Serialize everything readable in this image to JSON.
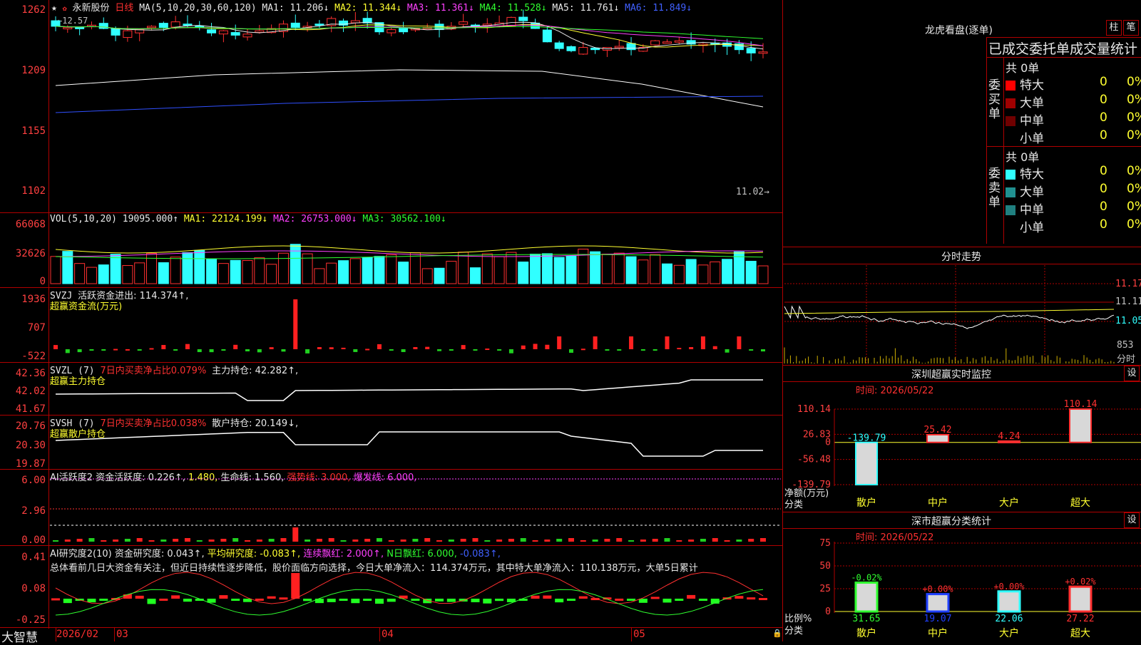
{
  "main_chart": {
    "star": "★",
    "stock_name": "永新股份",
    "period": "日线",
    "ma_header": "MA(5,10,20,30,60,120)",
    "ma1": "MA1: 11.206↓",
    "ma2": "MA2: 11.344↓",
    "ma3": "MA3: 11.361↓",
    "ma4": "MA4: 11.528↓",
    "ma5": "MA5: 11.761↓",
    "ma6": "MA6: 11.849↓",
    "high_label": "12.57",
    "low_label": "11.02→",
    "y_ticks": [
      "1262",
      "1209",
      "1155",
      "1102"
    ],
    "colors": {
      "ma1": "#e8e8e8",
      "ma2": "#ffff30",
      "ma3": "#ff40ff",
      "ma4": "#30ff30",
      "ma5": "#ffffff",
      "ma6": "#3050ff",
      "up": "#ff3030",
      "down": "#30ffff"
    }
  },
  "volume_panel": {
    "header": "VOL(5,10,20)",
    "value": "19095.000↑",
    "ma1": "MA1: 22124.199↓",
    "ma2": "MA2: 26753.000↓",
    "ma3": "MA3: 30562.100↓",
    "y_ticks": [
      "66068",
      "32626",
      "0"
    ]
  },
  "svzj_panel": {
    "header": "SVZJ",
    "line1": "活跃资金进出: 114.374↑,",
    "line2": "超赢资金流(万元)",
    "y_ticks": [
      "1936",
      "707",
      "-522"
    ]
  },
  "svzl_panel": {
    "header": "SVZL (7)",
    "ratio": "7日内买卖净占比0.079%",
    "holding": "主力持仓: 42.282↑,",
    "sub": "超赢主力持仓",
    "y_ticks": [
      "42.36",
      "42.02",
      "41.67"
    ]
  },
  "svsh_panel": {
    "header": "SVSH (7)",
    "ratio": "7日内买卖净占比0.038%",
    "holding": "散户持仓: 20.149↓,",
    "sub": "超赢散户持仓",
    "y_ticks": [
      "20.76",
      "20.30",
      "19.87"
    ]
  },
  "ai_active_panel": {
    "header": "AI活跃度2",
    "active": "资金活跃度: 0.226↑,",
    "v2": "1.480,",
    "life": "生命线: 1.560,",
    "strong": "强势线: 3.000,",
    "burst": "爆发线: 6.000,",
    "y_ticks": [
      "6.00",
      "2.96",
      "0.00"
    ]
  },
  "ai_research_panel": {
    "header": "AI研究度2(10)",
    "research": "资金研究度: 0.043↑,",
    "avg": "平均研究度: -0.083↑,",
    "consecutive": "连续飘红: 2.000↑,",
    "n_days": "N日飘红: 6.000,",
    "last": "-0.083↑,",
    "comment": "总体看前几日大资金有关注，但近日持续性逐步降低，股价面临方向选择，今日大单净流入：114.374万元，其中特大单净流入：110.138万元，大单5日累计",
    "y_ticks": [
      "0.41",
      "0.08",
      "-0.25"
    ]
  },
  "bottom_bar": {
    "brand": "大智慧",
    "date_start": "2026/02",
    "months": [
      "03",
      "04",
      "05"
    ]
  },
  "dragon_tiger": {
    "title": "龙虎看盘(逐单)",
    "btn1": "柱",
    "btn2": "笔",
    "subtitle": "已成交委托单成交量统计",
    "buy_label": "委买单",
    "sell_label": "委卖单",
    "buy_total": "共 0单",
    "sell_total": "共 0单",
    "rows": [
      {
        "name": "特大",
        "count": "0",
        "pct": "0%"
      },
      {
        "name": "大单",
        "count": "0",
        "pct": "0%"
      },
      {
        "name": "中单",
        "count": "0",
        "pct": "0%"
      },
      {
        "name": "小单",
        "count": "0",
        "pct": "0%"
      }
    ],
    "buy_colors": [
      "#ff0000",
      "#a00000",
      "#700000",
      "#000000"
    ],
    "sell_colors": [
      "#30ffff",
      "#209090",
      "#208080",
      "#000000"
    ]
  },
  "intraday": {
    "title": "分时走势",
    "y_ticks": [
      "11.17",
      "11.11",
      "11.05"
    ],
    "vol_label": "853",
    "vol_unit": "分时"
  },
  "sz_monitor": {
    "title": "深圳超赢实时监控",
    "settings": "设",
    "time": "时间: 2026/05/22",
    "y_ticks": [
      "110.14",
      "26.83",
      "0",
      "-56.48",
      "-139.79"
    ],
    "ylabel1": "净额(万元)",
    "ylabel2": "分类",
    "categories": [
      "散户",
      "中户",
      "大户",
      "超大"
    ],
    "values": [
      -139.79,
      25.42,
      4.24,
      110.14
    ],
    "value_labels": [
      "-139.79",
      "25.42",
      "4.24",
      "110.14"
    ]
  },
  "sz_classify": {
    "title": "深市超赢分类统计",
    "settings": "设",
    "time": "时间: 2026/05/22",
    "y_ticks": [
      "75",
      "50",
      "25",
      "0"
    ],
    "ylabel1": "比例%",
    "ylabel2": "分类",
    "categories": [
      "散户",
      "中户",
      "大户",
      "超大"
    ],
    "values": [
      31.65,
      19.07,
      22.06,
      27.22
    ],
    "value_labels": [
      "31.65",
      "19.07",
      "22.06",
      "27.22"
    ],
    "change_labels": [
      "-0.02%",
      "+0.00%",
      "+0.00%",
      "+0.02%"
    ],
    "bar_colors": [
      "#30ff30",
      "#2040ff",
      "#30ffff",
      "#ff3030"
    ]
  }
}
